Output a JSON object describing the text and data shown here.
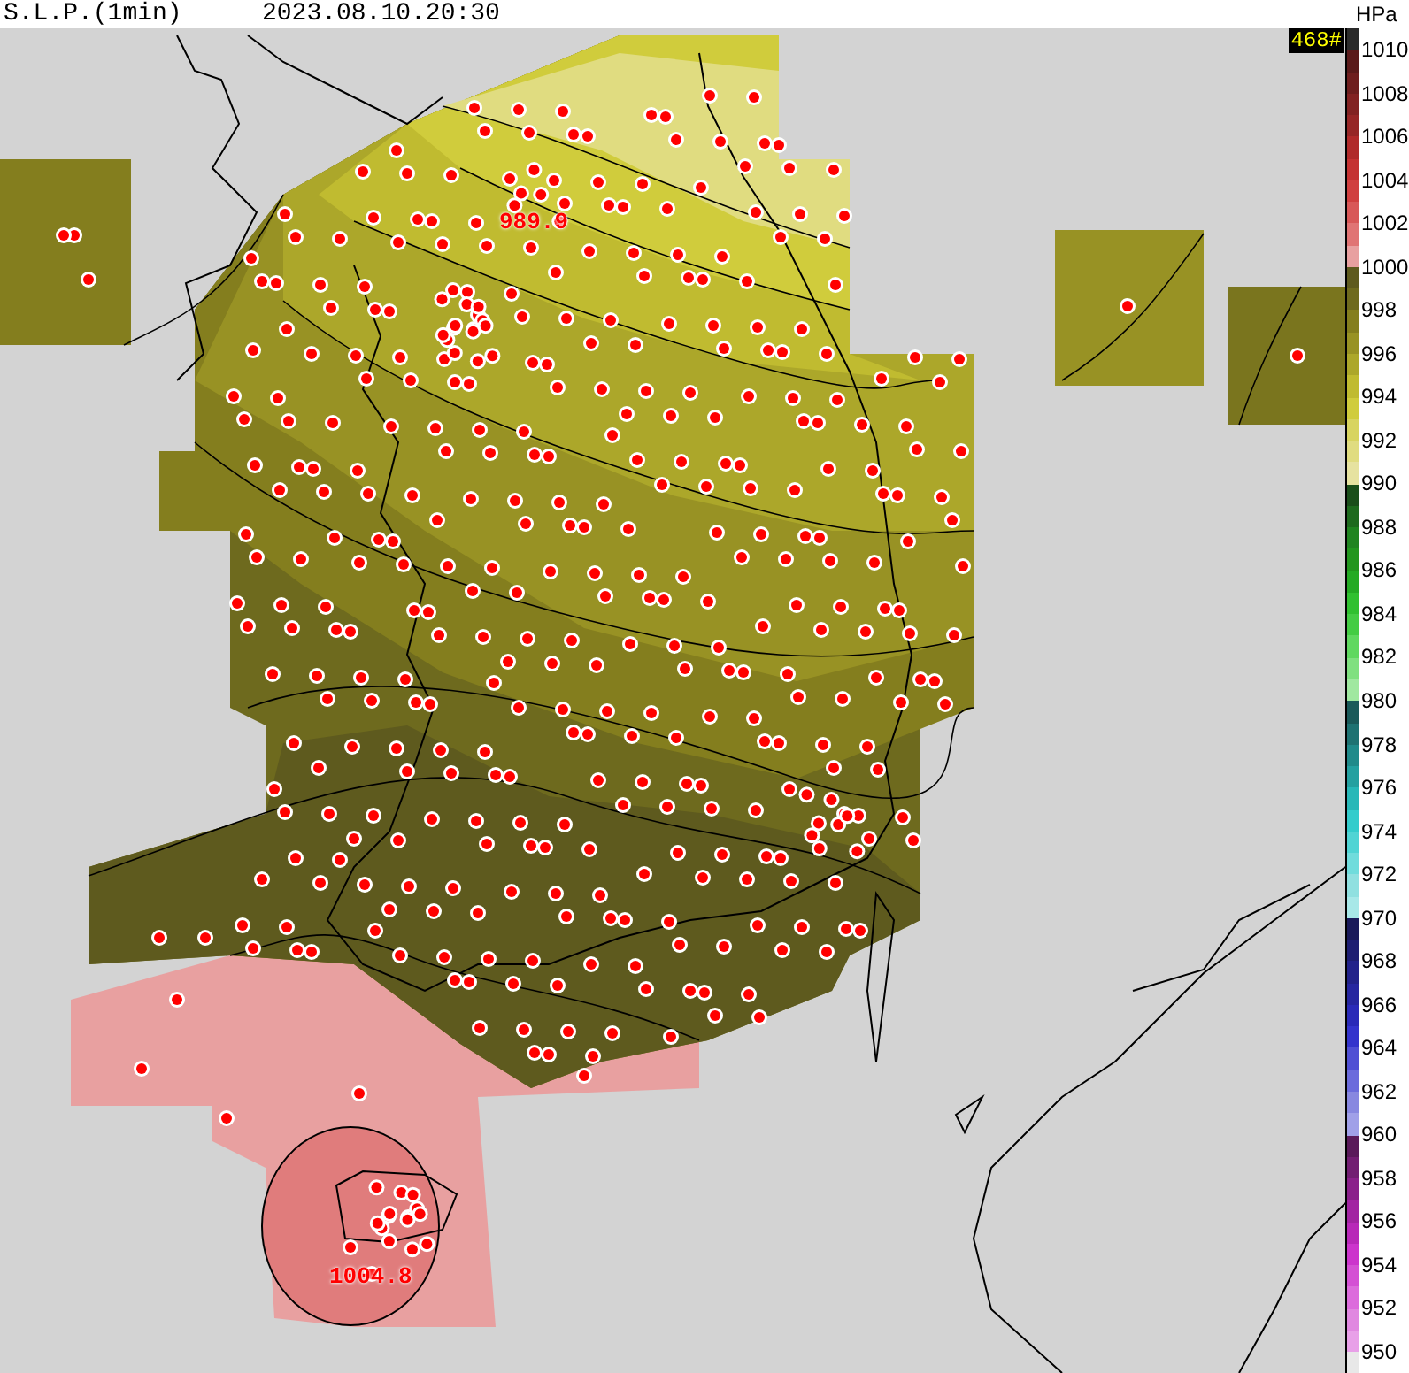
{
  "header": {
    "title": "S.L.P.(1min)",
    "timestamp": "2023.08.10.20:30",
    "unit": "HPa"
  },
  "map": {
    "station_count": "468#",
    "labels": [
      {
        "kind": "min",
        "text": "989.9"
      },
      {
        "kind": "max",
        "text": "1004.8"
      }
    ]
  },
  "legend": {
    "labels": [
      "1010",
      "1008",
      "1006",
      "1004",
      "1002",
      "1000",
      "998",
      "996",
      "994",
      "992",
      "990",
      "988",
      "986",
      "984",
      "982",
      "980",
      "978",
      "976",
      "974",
      "972",
      "970",
      "968",
      "966",
      "964",
      "962",
      "960",
      "958",
      "956",
      "954",
      "952",
      "950"
    ],
    "stripes": [
      {
        "color": "#2a2a2a"
      },
      {
        "color": "#5a1a1a"
      },
      {
        "color": "#6e1e1e"
      },
      {
        "color": "#822222"
      },
      {
        "color": "#962626"
      },
      {
        "color": "#b02a2a"
      },
      {
        "color": "#c43232"
      },
      {
        "color": "#d04040"
      },
      {
        "color": "#d85858"
      },
      {
        "color": "#e07474"
      },
      {
        "color": "#e8a0a0"
      },
      {
        "color": "#5e5a1e"
      },
      {
        "color": "#6e6a1e"
      },
      {
        "color": "#847e1e"
      },
      {
        "color": "#989224"
      },
      {
        "color": "#aca72a"
      },
      {
        "color": "#c0bb30"
      },
      {
        "color": "#d0cc3c"
      },
      {
        "color": "#d8d460"
      },
      {
        "color": "#e0dc80"
      },
      {
        "color": "#e6e2a0"
      },
      {
        "color": "#1a4e1a"
      },
      {
        "color": "#1e6a1e"
      },
      {
        "color": "#208420"
      },
      {
        "color": "#22961e"
      },
      {
        "color": "#24aa24"
      },
      {
        "color": "#30c030"
      },
      {
        "color": "#44cc44"
      },
      {
        "color": "#60d860"
      },
      {
        "color": "#80e080"
      },
      {
        "color": "#a0e8a0"
      },
      {
        "color": "#1a5a5a"
      },
      {
        "color": "#1e7272"
      },
      {
        "color": "#208a8a"
      },
      {
        "color": "#24a0a0"
      },
      {
        "color": "#28b8b8"
      },
      {
        "color": "#34cccc"
      },
      {
        "color": "#50d4d4"
      },
      {
        "color": "#70dcdc"
      },
      {
        "color": "#90e0e0"
      },
      {
        "color": "#a8e8e8"
      },
      {
        "color": "#1a1a5a"
      },
      {
        "color": "#1e1e72"
      },
      {
        "color": "#22228a"
      },
      {
        "color": "#2626a0"
      },
      {
        "color": "#2a2ab8"
      },
      {
        "color": "#3434cc"
      },
      {
        "color": "#5050d4"
      },
      {
        "color": "#6c6cdc"
      },
      {
        "color": "#8888e0"
      },
      {
        "color": "#a0a0e8"
      },
      {
        "color": "#5a1a5a"
      },
      {
        "color": "#721e72"
      },
      {
        "color": "#8a208a"
      },
      {
        "color": "#a224a2"
      },
      {
        "color": "#b828b8"
      },
      {
        "color": "#cc34cc"
      },
      {
        "color": "#d450d4"
      },
      {
        "color": "#dc6cdc"
      },
      {
        "color": "#e088e0"
      },
      {
        "color": "#e8a0e8"
      },
      {
        "color": "#e8e8e8"
      }
    ]
  }
}
